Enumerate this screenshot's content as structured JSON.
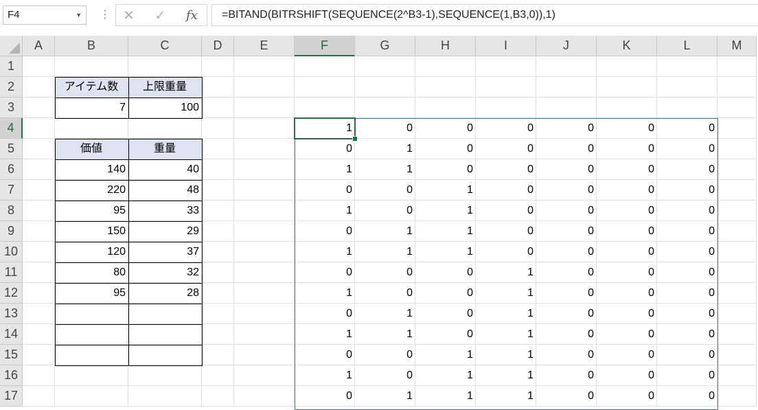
{
  "name_box": "F4",
  "formula": "=BITAND(BITRSHIFT(SEQUENCE(2^B3-1),SEQUENCE(1,B3,0)),1)",
  "fx_label": "fx",
  "columns": [
    "A",
    "B",
    "C",
    "D",
    "E",
    "F",
    "G",
    "H",
    "I",
    "J",
    "K",
    "L",
    "M"
  ],
  "rows": [
    "1",
    "2",
    "3",
    "4",
    "5",
    "6",
    "7",
    "8",
    "9",
    "10",
    "11",
    "12",
    "13",
    "14",
    "15",
    "16",
    "17"
  ],
  "selected_col": "F",
  "selected_row": "4",
  "settings_table": {
    "headers": [
      "アイテム数",
      "上限重量"
    ],
    "values": [
      "7",
      "100"
    ]
  },
  "items_table": {
    "headers": [
      "価値",
      "重量"
    ],
    "rows": [
      [
        "140",
        "40"
      ],
      [
        "220",
        "48"
      ],
      [
        "95",
        "33"
      ],
      [
        "150",
        "29"
      ],
      [
        "120",
        "37"
      ],
      [
        "80",
        "32"
      ],
      [
        "95",
        "28"
      ],
      [
        "",
        ""
      ],
      [
        "",
        ""
      ],
      [
        "",
        ""
      ]
    ]
  },
  "spill_values": [
    [
      "1",
      "0",
      "0",
      "0",
      "0",
      "0",
      "0"
    ],
    [
      "0",
      "1",
      "0",
      "0",
      "0",
      "0",
      "0"
    ],
    [
      "1",
      "1",
      "0",
      "0",
      "0",
      "0",
      "0"
    ],
    [
      "0",
      "0",
      "1",
      "0",
      "0",
      "0",
      "0"
    ],
    [
      "1",
      "0",
      "1",
      "0",
      "0",
      "0",
      "0"
    ],
    [
      "0",
      "1",
      "1",
      "0",
      "0",
      "0",
      "0"
    ],
    [
      "1",
      "1",
      "1",
      "0",
      "0",
      "0",
      "0"
    ],
    [
      "0",
      "0",
      "0",
      "1",
      "0",
      "0",
      "0"
    ],
    [
      "1",
      "0",
      "0",
      "1",
      "0",
      "0",
      "0"
    ],
    [
      "0",
      "1",
      "0",
      "1",
      "0",
      "0",
      "0"
    ],
    [
      "1",
      "1",
      "0",
      "1",
      "0",
      "0",
      "0"
    ],
    [
      "0",
      "0",
      "1",
      "1",
      "0",
      "0",
      "0"
    ],
    [
      "1",
      "0",
      "1",
      "1",
      "0",
      "0",
      "0"
    ],
    [
      "0",
      "1",
      "1",
      "1",
      "0",
      "0",
      "0"
    ]
  ],
  "colors": {
    "accent_green": "#217346",
    "spill_blue": "#4b6fb0",
    "header_fill": "#dde3f1"
  }
}
